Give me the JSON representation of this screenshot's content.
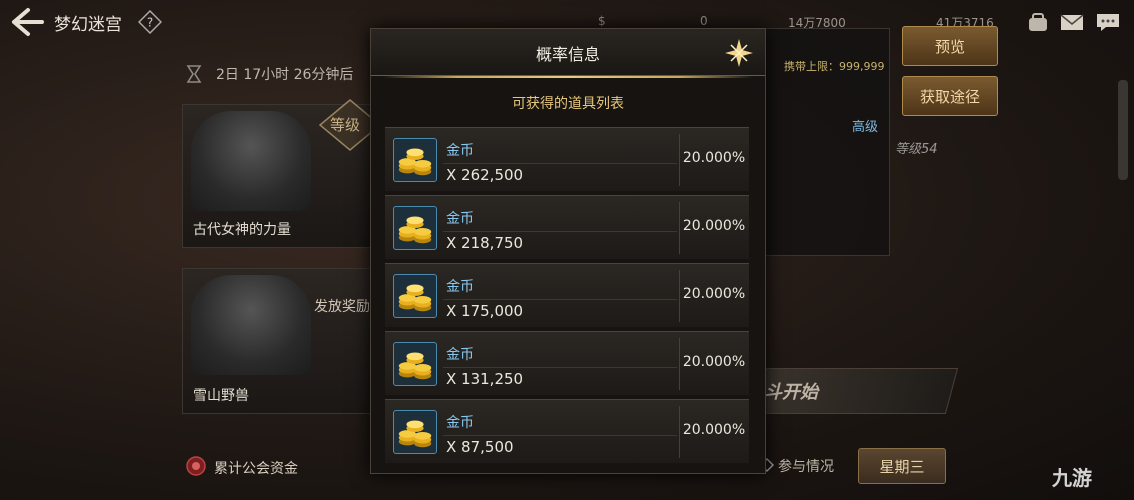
{
  "header": {
    "title": "梦幻迷宫",
    "currency_gold": "0",
    "currency_a": "14万7800",
    "currency_b": "41万3716"
  },
  "background": {
    "timer": "2日 17小时 26分钟后",
    "card1_label": "古代女神的力量",
    "card2_label": "雪山野兽",
    "level_badge": "等级",
    "reward_label": "发放奖励",
    "carry_limit": "携带上限：999,999",
    "behind_level_label": "高级",
    "behind_level_text": "等级54",
    "fight_label": "斗开始",
    "preview_button": "预览",
    "acquire_button": "获取途径"
  },
  "bottom": {
    "guild_fund": "累计公会资金",
    "participation": "参与情况",
    "weekday_button": "星期三",
    "watermark": "九游"
  },
  "modal": {
    "title": "概率信息",
    "subtitle": "可获得的道具列表",
    "items": [
      {
        "name": "金币",
        "qty": "X 262,500",
        "rate": "20.000%"
      },
      {
        "name": "金币",
        "qty": "X 218,750",
        "rate": "20.000%"
      },
      {
        "name": "金币",
        "qty": "X 175,000",
        "rate": "20.000%"
      },
      {
        "name": "金币",
        "qty": "X 131,250",
        "rate": "20.000%"
      },
      {
        "name": "金币",
        "qty": "X 87,500",
        "rate": "20.000%"
      }
    ]
  },
  "colors": {
    "accent_gold": "#e8c77a",
    "item_name_blue": "#88c8f0",
    "button_brown": "#7a5a30"
  },
  "icons": [
    "back-arrow-icon",
    "help-icon",
    "gold-coin-icon",
    "close-icon",
    "mail-icon",
    "chat-icon",
    "bag-icon",
    "timer-icon",
    "guild-icon"
  ]
}
